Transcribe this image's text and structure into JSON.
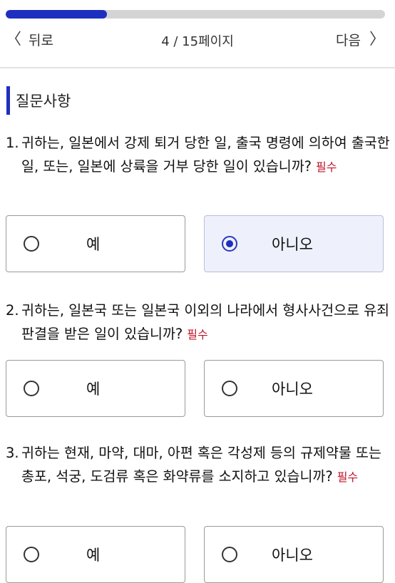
{
  "progress": {
    "current": 4,
    "total": 15,
    "fraction": 0.267
  },
  "nav": {
    "back_label": "뒤로",
    "page_label": "4 / 15페이지",
    "next_label": "다음"
  },
  "section": {
    "title": "질문사항"
  },
  "required_label": "필수",
  "questions": [
    {
      "number": "1.",
      "text": "귀하는, 일본에서 강제 퇴거 당한 일, 출국 명령에 의하여 출국한 일, 또는, 일본에 상륙을 거부 당한 일이 있습니까?",
      "options": [
        {
          "label": "예",
          "selected": false
        },
        {
          "label": "아니오",
          "selected": true
        }
      ]
    },
    {
      "number": "2.",
      "text": "귀하는, 일본국 또는 일본국 이외의 나라에서 형사사건으로 유죄판결을 받은 일이 있습니까?",
      "options": [
        {
          "label": "예",
          "selected": false
        },
        {
          "label": "아니오",
          "selected": false
        }
      ]
    },
    {
      "number": "3.",
      "text": "귀하는 현재, 마약, 대마, 아편 혹은 각성제 등의 규제약물 또는 총포, 석궁, 도검류 혹은 화약류를 소지하고 있습니까?",
      "options": [
        {
          "label": "예",
          "selected": false
        },
        {
          "label": "아니오",
          "selected": false
        }
      ]
    }
  ],
  "colors": {
    "accent": "#1e2fc0",
    "required": "#c0152a",
    "selected_bg": "#eef1fb"
  }
}
